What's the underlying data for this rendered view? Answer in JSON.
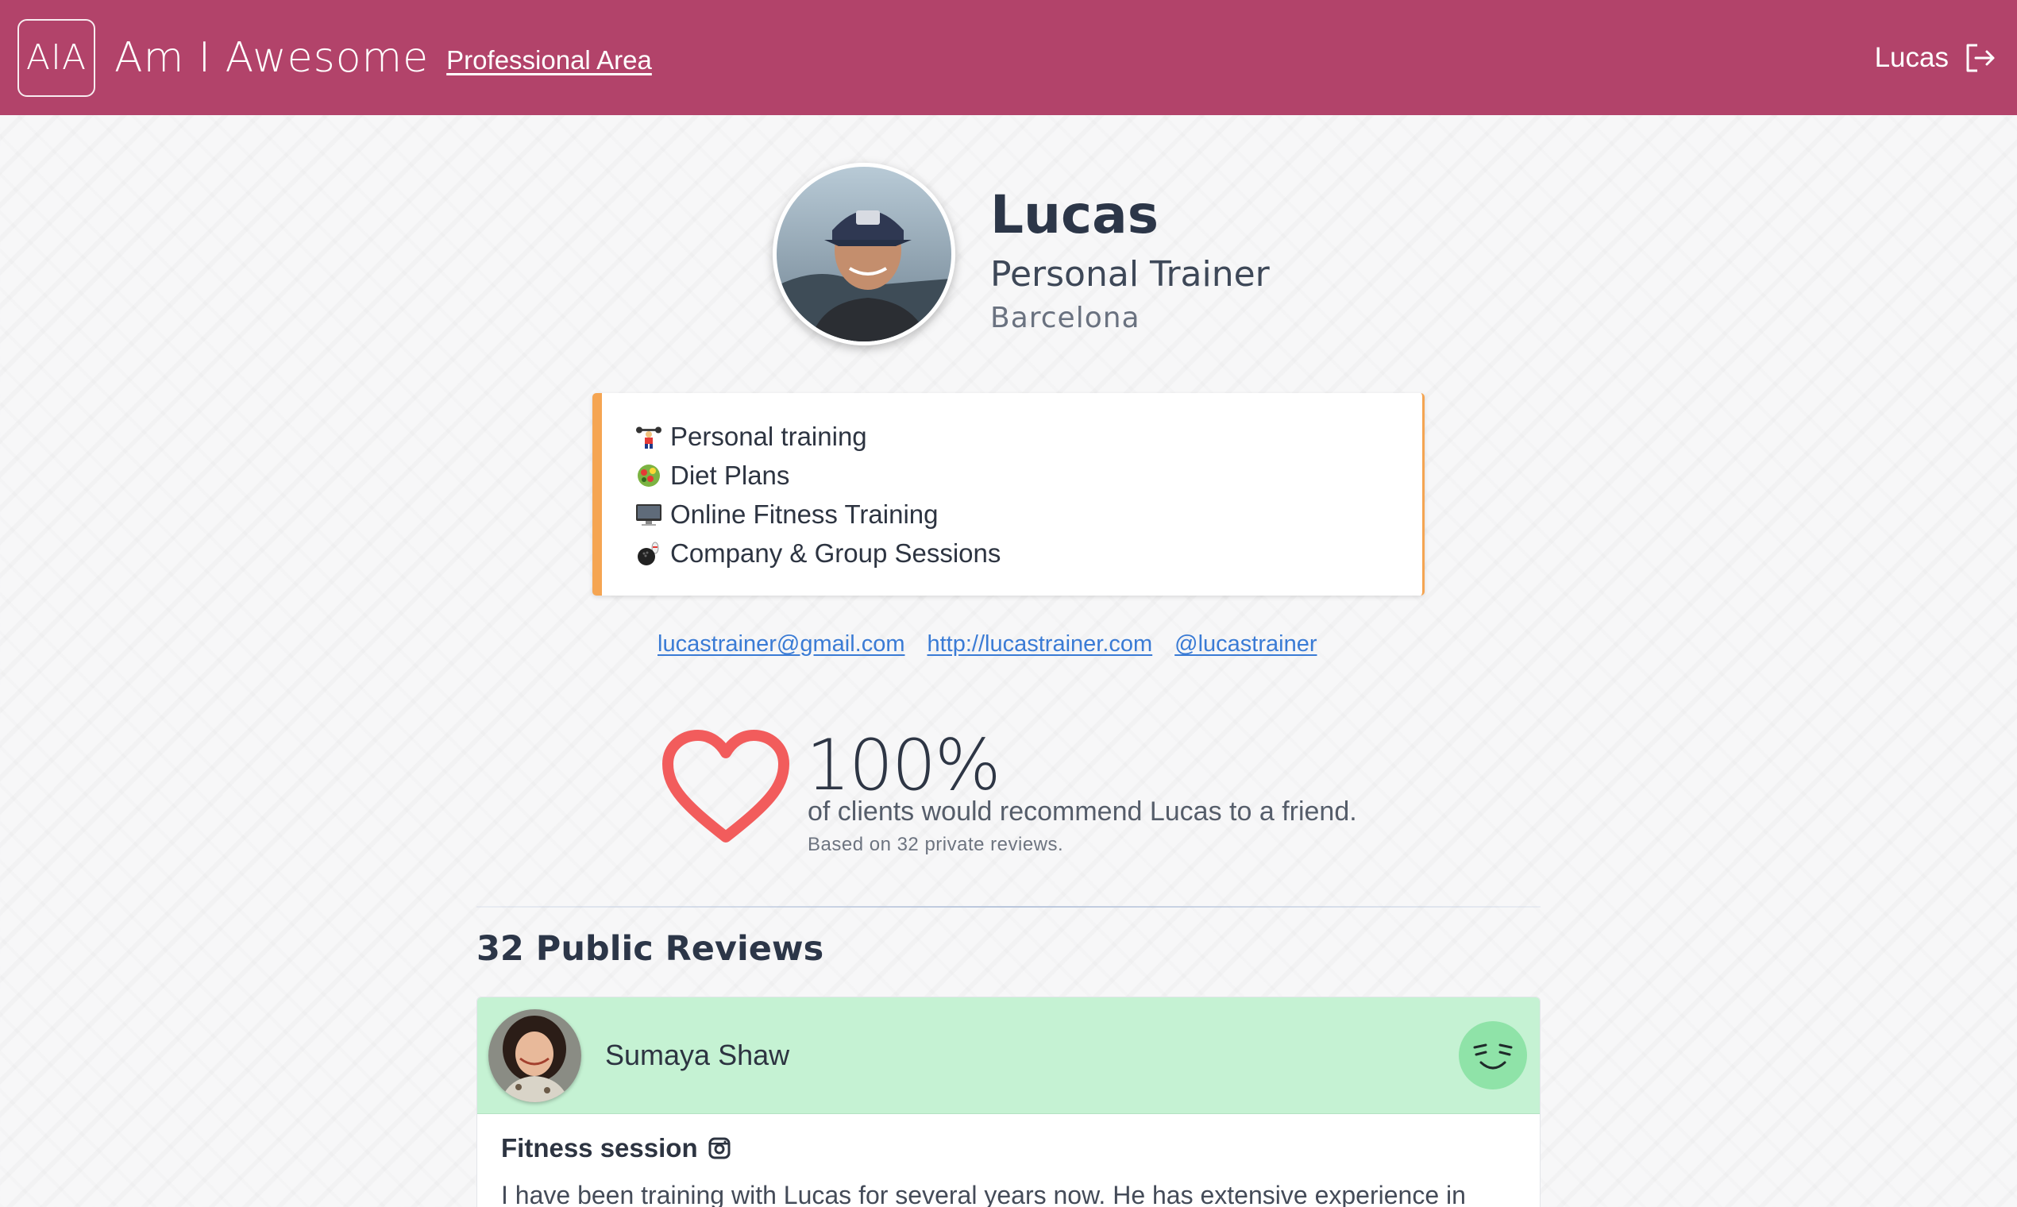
{
  "header": {
    "logo_text": "AIA",
    "brand": "Am I Awesome",
    "area_link": "Professional Area",
    "user_name": "Lucas",
    "bar_color": "#b2436a"
  },
  "profile": {
    "name": "Lucas",
    "role": "Personal Trainer",
    "city": "Barcelona"
  },
  "services": [
    {
      "icon": "weightlifter-icon",
      "label": "Personal training"
    },
    {
      "icon": "salad-icon",
      "label": "Diet Plans"
    },
    {
      "icon": "desktop-computer-icon",
      "label": "Online Fitness Training"
    },
    {
      "icon": "bowling-icon",
      "label": "Company & Group Sessions"
    }
  ],
  "links": {
    "email": "lucastrainer@gmail.com",
    "website": "http://lucastrainer.com",
    "social": "@lucastrainer"
  },
  "recommendation": {
    "percent": "100%",
    "line": "of clients would recommend Lucas to a friend.",
    "basis": "Based on 32 private reviews."
  },
  "reviews": {
    "title": "32 Public Reviews",
    "items": [
      {
        "reviewer": "Sumaya Shaw",
        "title": "Fitness session",
        "text": "I have been training with Lucas for several years now. He has extensive experience in",
        "mood": "happy-face-icon",
        "header_color": "#c5f2d3"
      }
    ]
  }
}
